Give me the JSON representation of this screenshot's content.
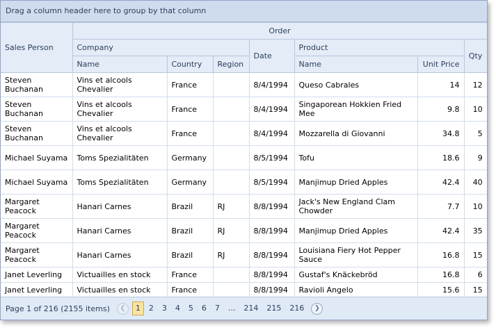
{
  "group_bar": "Drag a column header here to group by that column",
  "headers": {
    "sales_person": "Sales Person",
    "order": "Order",
    "company": "Company",
    "date": "Date",
    "product": "Product",
    "qty": "Qty",
    "company_name": "Name",
    "country": "Country",
    "region": "Region",
    "product_name": "Name",
    "unit_price": "Unit Price"
  },
  "rows": [
    {
      "sales": "Steven Buchanan",
      "company": "Vins et alcools Chevalier",
      "country": "France",
      "region": "",
      "date": "8/4/1994",
      "product": "Queso Cabrales",
      "price": "14",
      "qty": "12"
    },
    {
      "sales": "Steven Buchanan",
      "company": "Vins et alcools Chevalier",
      "country": "France",
      "region": "",
      "date": "8/4/1994",
      "product": "Singaporean Hokkien Fried Mee",
      "price": "9.8",
      "qty": "10"
    },
    {
      "sales": "Steven Buchanan",
      "company": "Vins et alcools Chevalier",
      "country": "France",
      "region": "",
      "date": "8/4/1994",
      "product": "Mozzarella di Giovanni",
      "price": "34.8",
      "qty": "5"
    },
    {
      "sales": "Michael Suyama",
      "company": "Toms Spezialitäten",
      "country": "Germany",
      "region": "",
      "date": "8/5/1994",
      "product": "Tofu",
      "price": "18.6",
      "qty": "9"
    },
    {
      "sales": "Michael Suyama",
      "company": "Toms Spezialitäten",
      "country": "Germany",
      "region": "",
      "date": "8/5/1994",
      "product": "Manjimup Dried Apples",
      "price": "42.4",
      "qty": "40"
    },
    {
      "sales": "Margaret Peacock",
      "company": "Hanari Carnes",
      "country": "Brazil",
      "region": "RJ",
      "date": "8/8/1994",
      "product": "Jack's New England Clam Chowder",
      "price": "7.7",
      "qty": "10"
    },
    {
      "sales": "Margaret Peacock",
      "company": "Hanari Carnes",
      "country": "Brazil",
      "region": "RJ",
      "date": "8/8/1994",
      "product": "Manjimup Dried Apples",
      "price": "42.4",
      "qty": "35"
    },
    {
      "sales": "Margaret Peacock",
      "company": "Hanari Carnes",
      "country": "Brazil",
      "region": "RJ",
      "date": "8/8/1994",
      "product": "Louisiana Fiery Hot Pepper Sauce",
      "price": "16.8",
      "qty": "15"
    },
    {
      "sales": "Janet Leverling",
      "company": "Victuailles en stock",
      "country": "France",
      "region": "",
      "date": "8/8/1994",
      "product": "Gustaf's Knäckebröd",
      "price": "16.8",
      "qty": "6"
    },
    {
      "sales": "Janet Leverling",
      "company": "Victuailles en stock",
      "country": "France",
      "region": "",
      "date": "8/8/1994",
      "product": "Ravioli Angelo",
      "price": "15.6",
      "qty": "15"
    }
  ],
  "pager": {
    "info": "Page 1 of 216 (2155 items)",
    "pages": [
      "1",
      "2",
      "3",
      "4",
      "5",
      "6",
      "7",
      "...",
      "214",
      "215",
      "216"
    ],
    "current": "1"
  }
}
